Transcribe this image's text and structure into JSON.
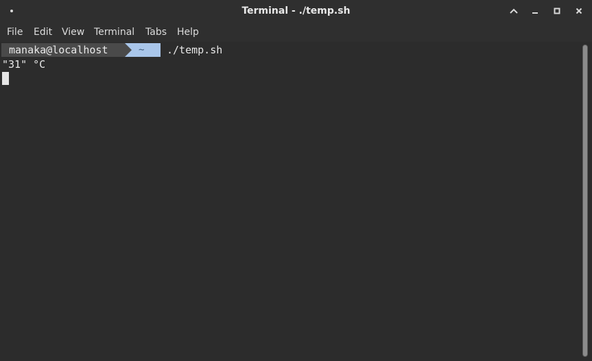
{
  "window": {
    "title": "Terminal - ./temp.sh"
  },
  "menubar": {
    "items": [
      "File",
      "Edit",
      "View",
      "Terminal",
      "Tabs",
      "Help"
    ]
  },
  "terminal": {
    "prompt_user": "manaka@localhost",
    "prompt_dir": "~",
    "command": "./temp.sh",
    "output_line": "\"31\" °C"
  },
  "colors": {
    "background": "#2c2c2c",
    "prompt_user_bg": "#4a4a4a",
    "prompt_dir_bg": "#a9c6ea",
    "text": "#e8e8e8"
  },
  "icons": {
    "window_menu": "window-menu-dot-icon",
    "shade": "chevron-up-icon",
    "minimize": "minimize-icon",
    "maximize": "maximize-icon",
    "close": "close-icon"
  }
}
